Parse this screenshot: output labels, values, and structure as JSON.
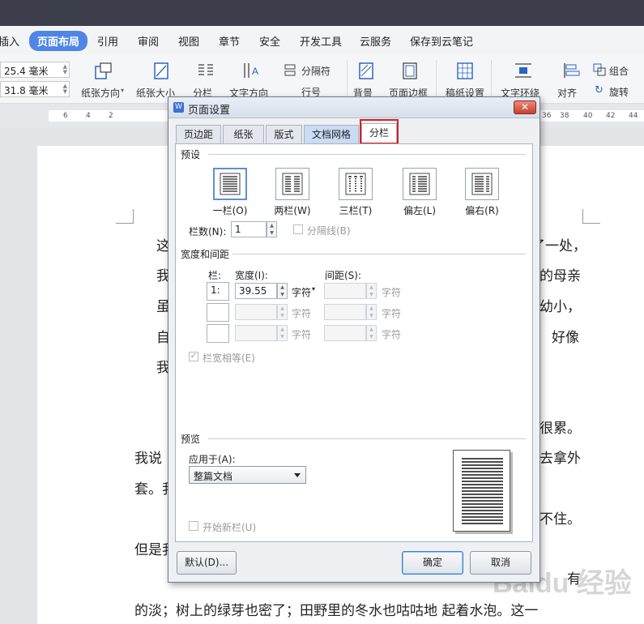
{
  "menu": {
    "items": [
      "插入",
      "页面布局",
      "引用",
      "审阅",
      "视图",
      "章节",
      "安全",
      "开发工具",
      "云服务",
      "保存到云笔记"
    ],
    "active": "页面布局"
  },
  "ribbon": {
    "margin_top": "25.4 毫米",
    "margin_bottom": "31.8 毫米",
    "labels": {
      "orientation": "纸张方向",
      "size": "纸张大小",
      "columns": "分栏",
      "text_dir": "文字方向",
      "separator": "分隔符",
      "line_num": "行号",
      "background": "背景",
      "page_border": "页面边框",
      "draft": "稿纸设置",
      "wrap": "文字环绕",
      "align": "对齐",
      "group": "组合",
      "rotate": "旋转"
    }
  },
  "ruler": {
    "numbers": [
      "6",
      "4",
      "2",
      "36",
      "38",
      "40",
      "42",
      "44"
    ]
  },
  "document": {
    "lines": [
      "这",
      "了一处，",
      "我",
      "的母亲",
      "虽",
      "幼小，",
      "自",
      "好像",
      "我",
      "有",
      "很累。",
      "我说",
      "去拿外",
      "套。我",
      "不住。",
      "但是我",
      "的淡；树上的绿芽也密了；田野里的冬水也咕咕地  起着水泡。这一"
    ]
  },
  "dialog": {
    "title": "页面设置",
    "close": "✕",
    "tabs": [
      "页边距",
      "纸张",
      "版式",
      "文档网格",
      "分栏"
    ],
    "active_tab": "分栏",
    "presets_label": "预设",
    "presets": [
      "一栏(O)",
      "两栏(W)",
      "三栏(T)",
      "偏左(L)",
      "偏右(R)"
    ],
    "selected_preset": "一栏(O)",
    "num_cols_label": "栏数(N):",
    "num_cols_value": "1",
    "divider_label": "分隔线(B)",
    "width_spacing_label": "宽度和间距",
    "col_header": "栏:",
    "width_header": "宽度(I):",
    "spacing_header": "间距(S):",
    "row1_col": "1:",
    "row1_width": "39.55",
    "unit": "字符",
    "equal_width_label": "栏宽相等(E)",
    "preview_label": "预览",
    "apply_to_label": "应用于(A):",
    "apply_to_value": "整篇文档",
    "new_column_label": "开始新栏(U)",
    "default_button": "默认(D)...",
    "ok_button": "确定",
    "cancel_button": "取消"
  },
  "watermark": "Baidu 经验"
}
